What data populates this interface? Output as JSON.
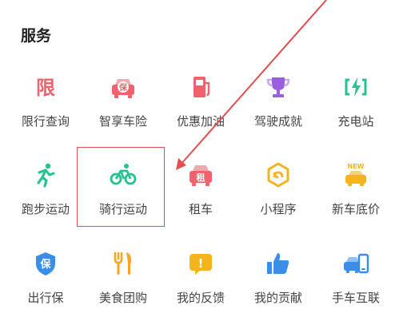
{
  "section": {
    "title": "服务"
  },
  "items": [
    {
      "label": "限行查询",
      "icon": "restriction-icon",
      "glyph": "限",
      "color": "#f0626e"
    },
    {
      "label": "智享车险",
      "icon": "car-insurance-icon",
      "glyph": "保",
      "color": "#f0626e"
    },
    {
      "label": "优惠加油",
      "icon": "fuel-pump-icon",
      "color": "#f0626e"
    },
    {
      "label": "驾驶成就",
      "icon": "trophy-icon",
      "color": "#9b5fe0"
    },
    {
      "label": "充电站",
      "icon": "charging-icon",
      "color": "#27c28f"
    },
    {
      "label": "跑步运动",
      "icon": "runner-icon",
      "color": "#27c28f"
    },
    {
      "label": "骑行运动",
      "icon": "bicycle-icon",
      "color": "#27c28f"
    },
    {
      "label": "租车",
      "icon": "car-rental-icon",
      "glyph": "租",
      "color": "#f0626e"
    },
    {
      "label": "小程序",
      "icon": "mini-program-icon",
      "color": "#f5b41c"
    },
    {
      "label": "新车底价",
      "icon": "new-car-icon",
      "glyph": "NEW",
      "color": "#f5b41c"
    },
    {
      "label": "出行保",
      "icon": "shield-icon",
      "glyph": "保",
      "color": "#3b8ee8"
    },
    {
      "label": "美食团购",
      "icon": "fork-knife-icon",
      "color": "#f5a623"
    },
    {
      "label": "我的反馈",
      "icon": "feedback-icon",
      "glyph": "!",
      "color": "#f5b41c"
    },
    {
      "label": "我的贡献",
      "icon": "thumbs-up-icon",
      "color": "#3b8ee8"
    },
    {
      "label": "手车互联",
      "icon": "car-phone-link-icon",
      "color": "#3b8ee8"
    }
  ],
  "annotation": {
    "color": "#e05050"
  }
}
